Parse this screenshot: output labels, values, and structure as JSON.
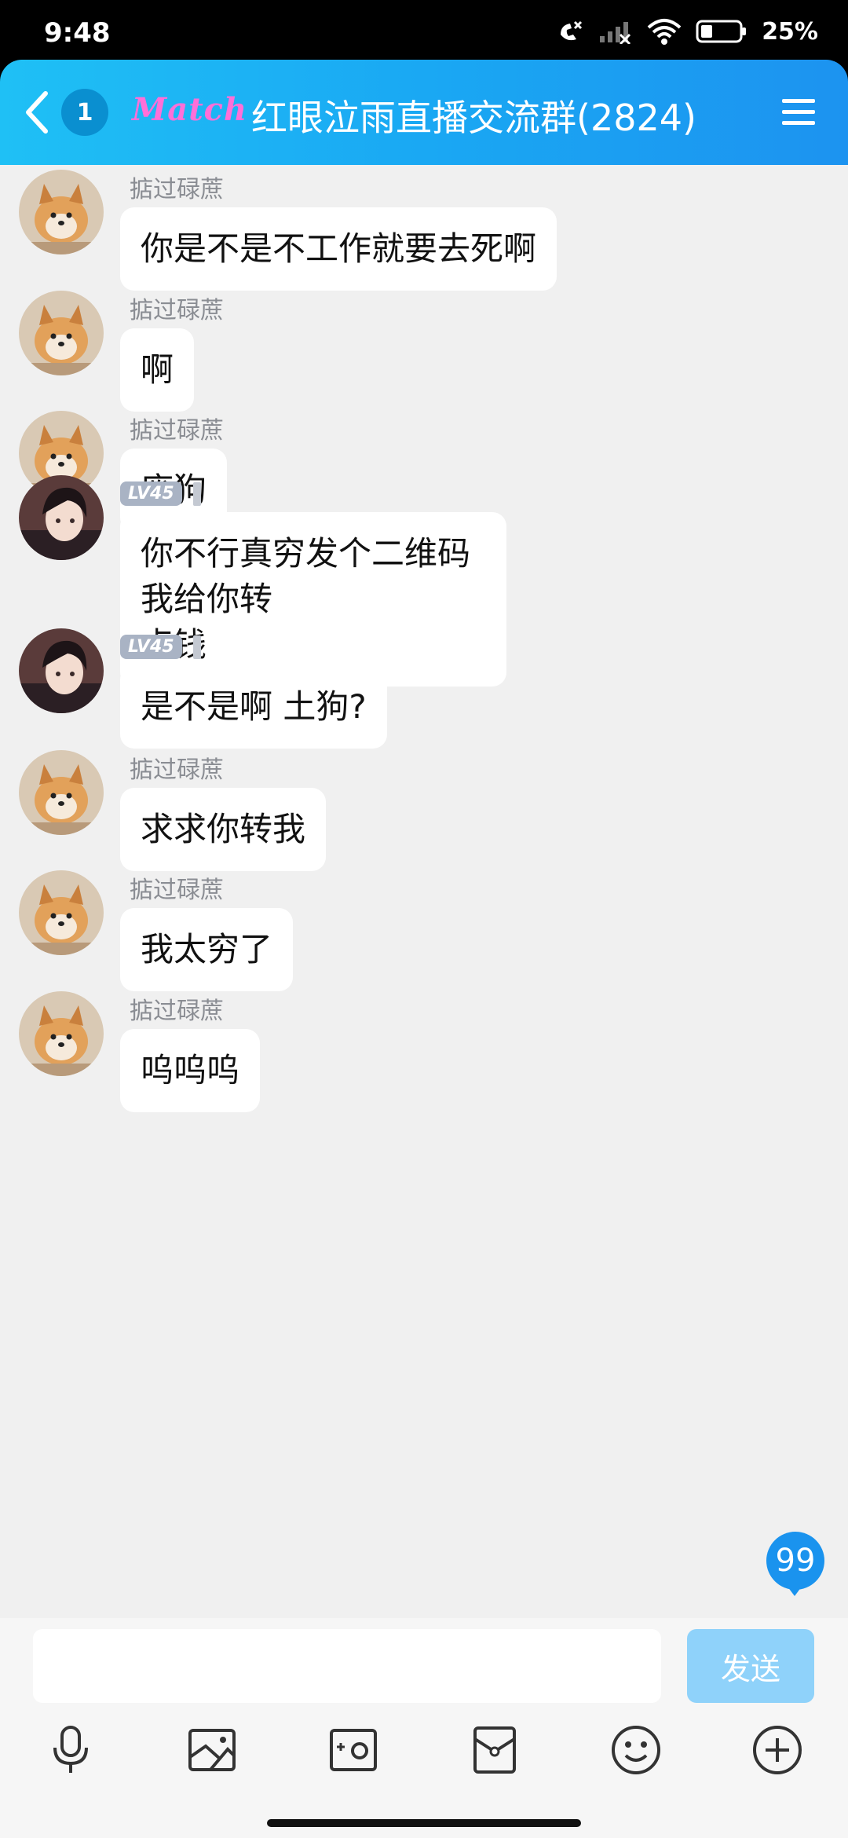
{
  "status": {
    "time": "9:48",
    "battery": "25%"
  },
  "header": {
    "back_count": "1",
    "logo_text": "Match",
    "title": "红眼泣雨直播交流群(2824)"
  },
  "messages": [
    {
      "sender": "掂过碌蔗",
      "level": "",
      "text": "你是不是不工作就要去死啊",
      "text2": ""
    },
    {
      "sender": "掂过碌蔗",
      "level": "",
      "text": "啊",
      "text2": ""
    },
    {
      "sender": "掂过碌蔗",
      "level": "",
      "text": "废狗",
      "text2": ""
    },
    {
      "sender": "",
      "level": "LV45",
      "text": "你不行真穷发个二维码 我给你转",
      "text2": "点钱"
    },
    {
      "sender": "",
      "level": "LV45",
      "text": "是不是啊 土狗?",
      "text2": ""
    },
    {
      "sender": "掂过碌蔗",
      "level": "",
      "text": "求求你转我",
      "text2": ""
    },
    {
      "sender": "掂过碌蔗",
      "level": "",
      "text": "我太穷了",
      "text2": ""
    },
    {
      "sender": "掂过碌蔗",
      "level": "",
      "text": "呜呜呜",
      "text2": ""
    }
  ],
  "unread_count": "99",
  "input": {
    "placeholder": "",
    "send_label": "发送"
  },
  "toolbar": [
    "mic-icon",
    "image-icon",
    "camera-icon",
    "red-packet-icon",
    "emoji-icon",
    "plus-icon"
  ],
  "colors": {
    "header_start": "#1fc0f5",
    "header_end": "#1c93f0",
    "logo": "#ff6fd8",
    "send_disabled": "#8fd2fa",
    "unread": "#1a93ee"
  }
}
